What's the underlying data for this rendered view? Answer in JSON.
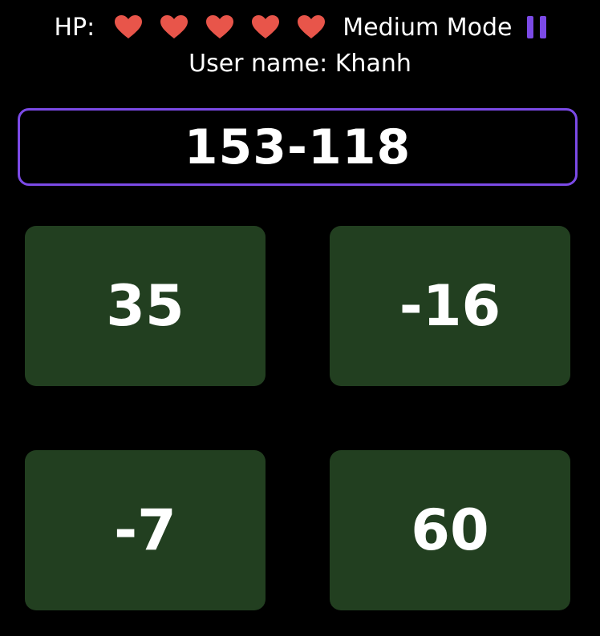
{
  "status": {
    "hp_label": "HP:",
    "hearts": 5,
    "heart_color": "#e8554a",
    "mode_label": "Medium Mode",
    "pause_icon": "pause-icon",
    "accent_color": "#7b4ae6"
  },
  "user": {
    "label": "User name: Khanh"
  },
  "question": {
    "expression": "153-118"
  },
  "answers": [
    {
      "value": "35"
    },
    {
      "value": "-16"
    },
    {
      "value": "-7"
    },
    {
      "value": "60"
    }
  ],
  "colors": {
    "answer_bg": "#223f20",
    "background": "#000000",
    "text": "#ffffff"
  }
}
